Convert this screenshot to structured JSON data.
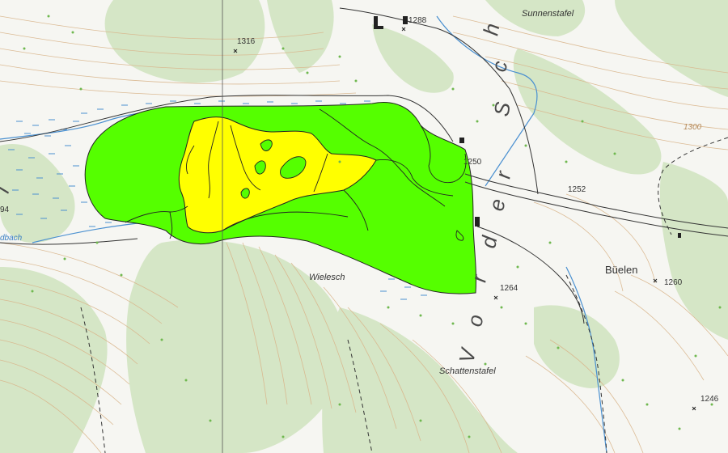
{
  "map": {
    "spot_heights": [
      {
        "id": "h1288",
        "label": "1288"
      },
      {
        "id": "h1316",
        "label": "1316"
      },
      {
        "id": "h1250",
        "label": "1250"
      },
      {
        "id": "h1252",
        "label": "1252"
      },
      {
        "id": "h1264",
        "label": "1264"
      },
      {
        "id": "h1260",
        "label": "1260"
      },
      {
        "id": "h1246",
        "label": "1246"
      },
      {
        "id": "h94",
        "label": "94"
      }
    ],
    "place_names": {
      "sunnenstafel": "Sunnenstafel",
      "wielesch": "Wielesch",
      "schattenstafel": "Schattenstafel",
      "bueelen": "Büelen"
    },
    "contour_label": "1300",
    "water_label": "dbach",
    "valley_name_letters": [
      "V",
      "o",
      "r",
      "d",
      "e",
      "r",
      "S",
      "c",
      "h"
    ],
    "edge_letter": "l",
    "colors": {
      "zone_green": "#55ff00",
      "zone_yellow": "#ffff00",
      "forest": "#d6e8c8",
      "water": "#3a7fc4",
      "contour": "#d8b48a",
      "road": "#333333"
    }
  }
}
